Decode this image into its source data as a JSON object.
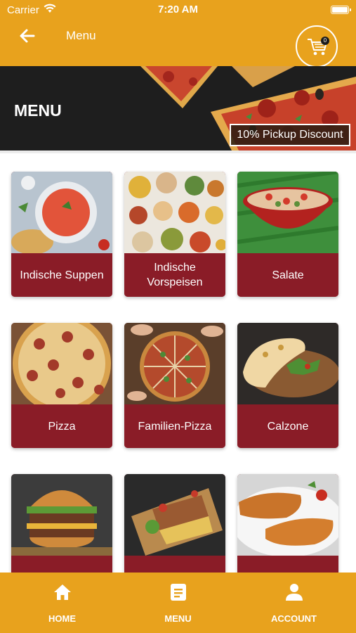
{
  "status_bar": {
    "carrier": "Carrier",
    "time": "7:20 AM"
  },
  "header": {
    "title": "Menu",
    "cart_count": "0"
  },
  "hero": {
    "title": "MENU",
    "discount": "10% Pickup Discount"
  },
  "categories": [
    {
      "label": "Indische Suppen"
    },
    {
      "label": "Indische Vorspeisen"
    },
    {
      "label": "Salate"
    },
    {
      "label": "Pizza"
    },
    {
      "label": "Familien-Pizza"
    },
    {
      "label": "Calzone"
    },
    {
      "label": ""
    },
    {
      "label": ""
    },
    {
      "label": ""
    }
  ],
  "bottom_nav": [
    {
      "label": "HOME",
      "icon": "home-icon"
    },
    {
      "label": "MENU",
      "icon": "menu-list-icon"
    },
    {
      "label": "ACCOUNT",
      "icon": "account-icon"
    }
  ],
  "colors": {
    "brand": "#e8a21d",
    "card_label": "#8a1c27",
    "hero_bg": "#1e1e1e"
  }
}
